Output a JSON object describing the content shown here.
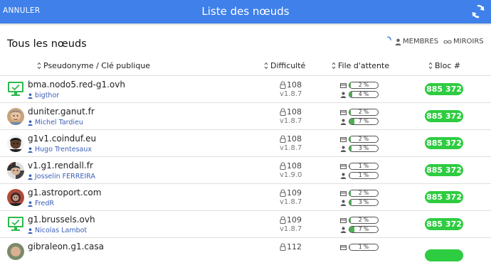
{
  "topbar": {
    "cancel_label": "ANNULER",
    "title": "Liste des nœuds"
  },
  "section": {
    "title": "Tous les nœuds"
  },
  "filters": {
    "members_label": "MEMBRES",
    "mirrors_label": "MIROIRS"
  },
  "columns": {
    "pseudo": "Pseudonyme / Clé publique",
    "difficulty": "Difficulté",
    "queue": "File d'attente",
    "block": "Bloc #"
  },
  "colors": {
    "accent": "#3f80ea",
    "badge": "#2ecc40",
    "queue_fill": "#4caf50",
    "uid_link": "#3b5fb8"
  },
  "rows": [
    {
      "icon": "server-icon",
      "host": "bma.nodo5.red-g1.ovh",
      "uid": "bigthor",
      "difficulty": "108",
      "version": "v1.8.7",
      "queue_pool": "2 %",
      "queue_pool_value": 0.02,
      "queue_member": "4 %",
      "queue_member_value": 0.04,
      "block": "885 372"
    },
    {
      "icon": "avatar",
      "host": "duniter.ganut.fr",
      "uid": "Michel Tardieu",
      "difficulty": "108",
      "version": "v1.8.7",
      "queue_pool": "2 %",
      "queue_pool_value": 0.02,
      "queue_member": "7 %",
      "queue_member_value": 0.07,
      "block": "885 372"
    },
    {
      "icon": "avatar",
      "host": "g1v1.coinduf.eu",
      "uid": "Hugo Trentesaux",
      "difficulty": "108",
      "version": "v1.8.7",
      "queue_pool": "2 %",
      "queue_pool_value": 0.02,
      "queue_member": "3 %",
      "queue_member_value": 0.03,
      "block": "885 372"
    },
    {
      "icon": "avatar",
      "host": "v1.g1.rendall.fr",
      "uid": "Josselin FERREIRA",
      "difficulty": "108",
      "version": "v1.9.0",
      "queue_pool": "1 %",
      "queue_pool_value": 0.01,
      "queue_member": "1 %",
      "queue_member_value": 0.01,
      "block": "885 372"
    },
    {
      "icon": "avatar",
      "host": "g1.astroport.com",
      "uid": "FredR",
      "difficulty": "109",
      "version": "v1.8.7",
      "queue_pool": "2 %",
      "queue_pool_value": 0.02,
      "queue_member": "3 %",
      "queue_member_value": 0.03,
      "block": "885 372"
    },
    {
      "icon": "server-icon",
      "host": "g1.brussels.ovh",
      "uid": "Nicolas Lambot",
      "difficulty": "109",
      "version": "v1.8.7",
      "queue_pool": "2 %",
      "queue_pool_value": 0.02,
      "queue_member": "7 %",
      "queue_member_value": 0.07,
      "block": "885 372"
    },
    {
      "icon": "avatar",
      "host": "gibraleon.g1.casa",
      "uid": "",
      "difficulty": "112",
      "version": "",
      "queue_pool": "1 %",
      "queue_pool_value": 0.01,
      "queue_member": "",
      "queue_member_value": 0,
      "block": ""
    }
  ]
}
